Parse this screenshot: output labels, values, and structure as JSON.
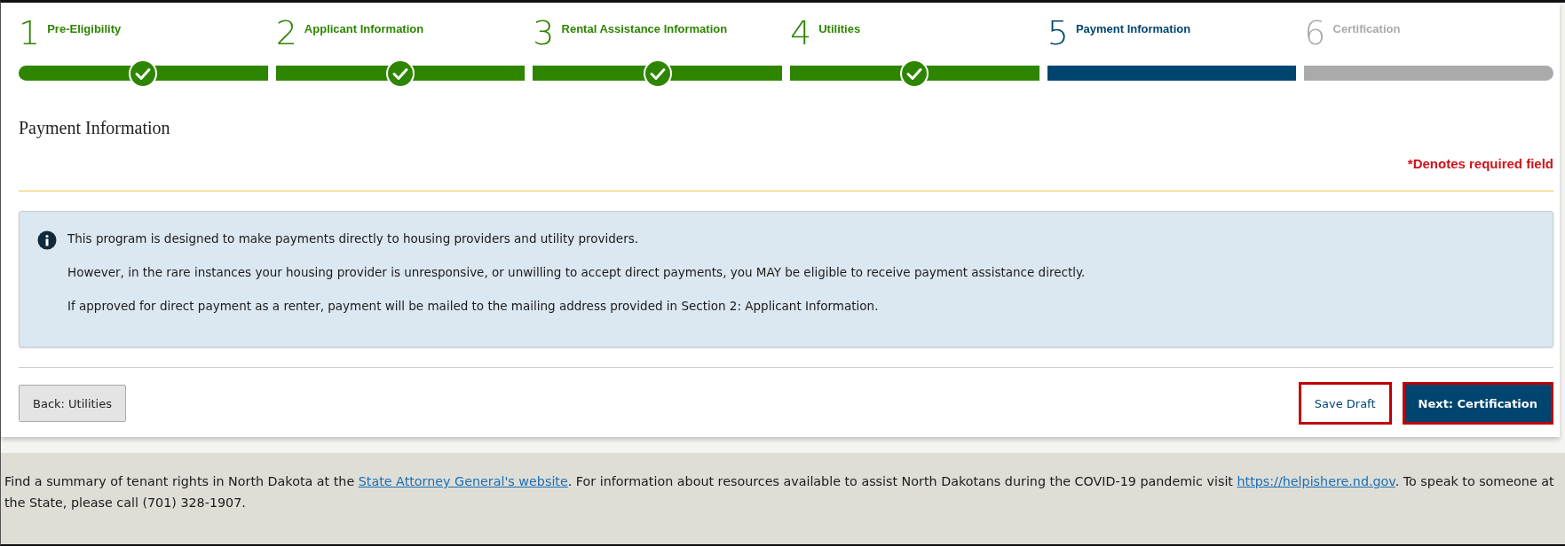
{
  "steps": [
    {
      "number": "1",
      "label": "Pre-Eligibility",
      "completed": true,
      "selected": false
    },
    {
      "number": "2",
      "label": "Applicant Information",
      "completed": true,
      "selected": false
    },
    {
      "number": "3",
      "label": "Rental Assistance Information",
      "completed": true,
      "selected": false
    },
    {
      "number": "4",
      "label": "Utilities",
      "completed": true,
      "selected": false
    },
    {
      "number": "5",
      "label": "Payment Information",
      "completed": false,
      "selected": true
    },
    {
      "number": "6",
      "label": "Certification",
      "completed": false,
      "selected": false
    }
  ],
  "section_title": "Payment Information",
  "required_note": "*Denotes required field",
  "info_box": {
    "paragraphs": [
      "This program is designed to make payments directly to housing providers and utility providers.",
      "However, in the rare instances your housing provider is unresponsive, or unwilling to accept direct payments, you MAY be eligible to receive payment assistance directly.",
      "If approved for direct payment as a renter, payment will be mailed to the mailing address provided in Section 2: Applicant Information."
    ]
  },
  "buttons": [
    {
      "label": "Back: Utilities",
      "kind": "secondary",
      "highlighted": false
    },
    {
      "label": "Save Draft",
      "kind": "outline",
      "highlighted": true
    },
    {
      "label": "Next: Certification",
      "kind": "primary",
      "highlighted": true
    }
  ],
  "footer": {
    "segments": [
      {
        "kind": "text",
        "text": "Find a summary of tenant rights in North Dakota at the "
      },
      {
        "kind": "link",
        "text": "State Attorney General's website"
      },
      {
        "kind": "text",
        "text": ". For information about resources available to assist North Dakotans during the COVID-19 pandemic visit "
      },
      {
        "kind": "link",
        "text": "https://helpishere.nd.gov"
      },
      {
        "kind": "text",
        "text": ". To speak to someone at the State, please call (701) 328-1907."
      }
    ]
  }
}
